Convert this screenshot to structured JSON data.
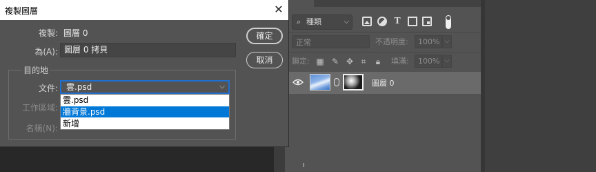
{
  "dialog": {
    "title": "複製圖層",
    "close_glyph": "✕",
    "duplicate_label": "複製:",
    "duplicate_value": "圖層 0",
    "as_label": "為(A):",
    "as_value": "圖層 0 拷貝",
    "ok_label": "確定",
    "cancel_label": "取消",
    "destination": {
      "legend": "目的地",
      "document_label": "文件:",
      "document_value": "雲.psd",
      "artboard_label": "工作區域:",
      "name_label": "名稱(N):",
      "options": [
        "雲.psd",
        "牆背景.psd",
        "新增"
      ],
      "highlighted_index": 1
    }
  },
  "layers_panel": {
    "filter_placeholder": "種類",
    "blend_mode": "正常",
    "opacity_label": "不透明度:",
    "opacity_value": "100%",
    "lock_label": "鎖定:",
    "fill_label": "填滿:",
    "fill_value": "100%",
    "layer_name": "圖層 0"
  },
  "colors": {
    "accent_blue": "#1e6fd0",
    "selection_blue": "#0078d7",
    "dialog_bg": "#535353"
  }
}
